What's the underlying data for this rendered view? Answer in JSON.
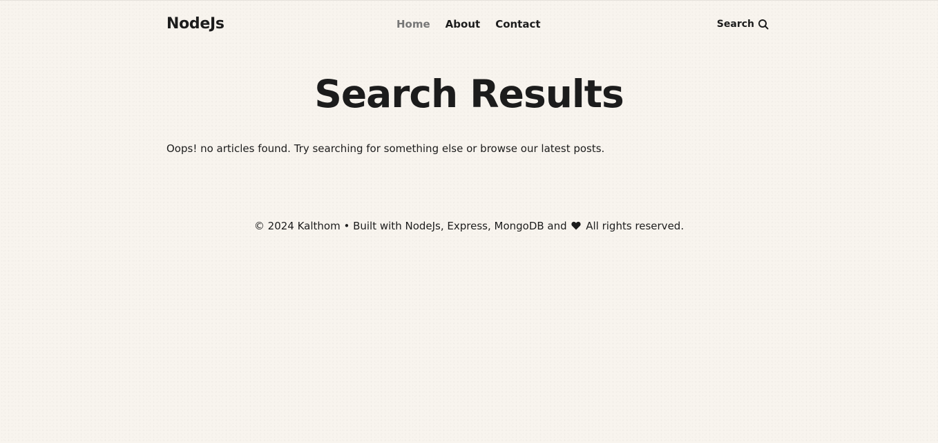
{
  "header": {
    "logo": "NodeJs",
    "nav": [
      {
        "label": "Home",
        "active": true
      },
      {
        "label": "About",
        "active": false
      },
      {
        "label": "Contact",
        "active": false
      }
    ],
    "search_label": "Search",
    "search_icon": "search-icon"
  },
  "main": {
    "title": "Search Results",
    "message": "Oops! no articles found. Try searching for something else or browse our latest posts."
  },
  "footer": {
    "text_before": "© 2024 Kalthom • Built with NodeJs, Express, MongoDB and",
    "heart_icon": "heart-icon",
    "text_after": "All rights reserved."
  },
  "colors": {
    "background": "#f8f4ee",
    "text": "#1c1c1c",
    "active_nav": "#777777"
  }
}
